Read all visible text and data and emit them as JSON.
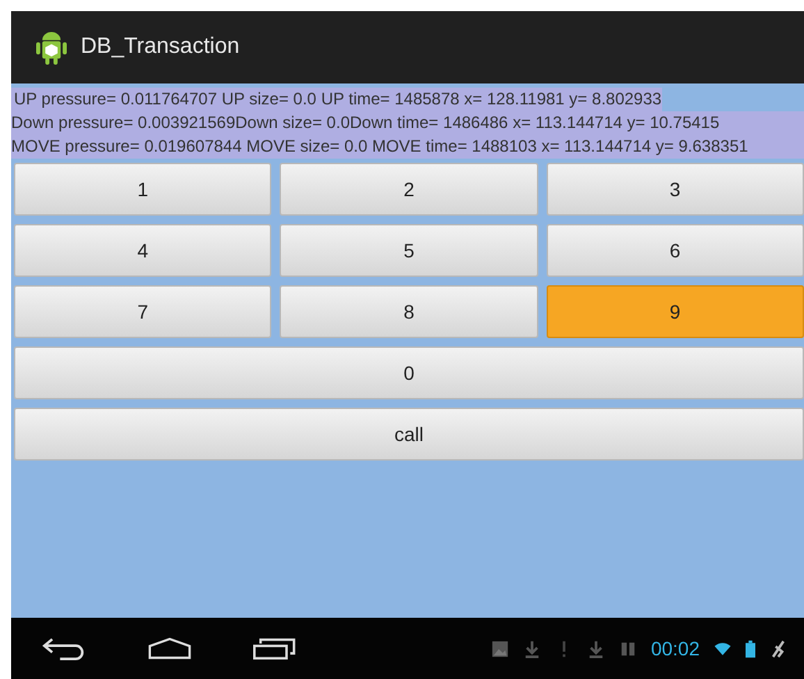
{
  "title_bar": {
    "title": "DB_Transaction"
  },
  "log_lines": [
    "UP pressure= 0.011764707 UP  size= 0.0 UP  time= 1485878  x= 128.11981  y= 8.802933",
    "Down pressure= 0.003921569Down size= 0.0Down time= 1486486 x= 113.144714 y= 10.75415",
    "MOVE pressure= 0.019607844 MOVE  size= 0.0 MOVE  time= 1488103  x= 113.144714  y= 9.638351"
  ],
  "keypad": [
    [
      {
        "label": "1",
        "selected": false
      },
      {
        "label": "2",
        "selected": false
      },
      {
        "label": "3",
        "selected": false
      }
    ],
    [
      {
        "label": "4",
        "selected": false
      },
      {
        "label": "5",
        "selected": false
      },
      {
        "label": "6",
        "selected": false
      }
    ],
    [
      {
        "label": "7",
        "selected": false
      },
      {
        "label": "8",
        "selected": false
      },
      {
        "label": "9",
        "selected": true
      }
    ],
    [
      {
        "label": "0",
        "selected": false
      }
    ],
    [
      {
        "label": "call",
        "selected": false
      }
    ]
  ],
  "status_bar": {
    "time": "00:02"
  }
}
